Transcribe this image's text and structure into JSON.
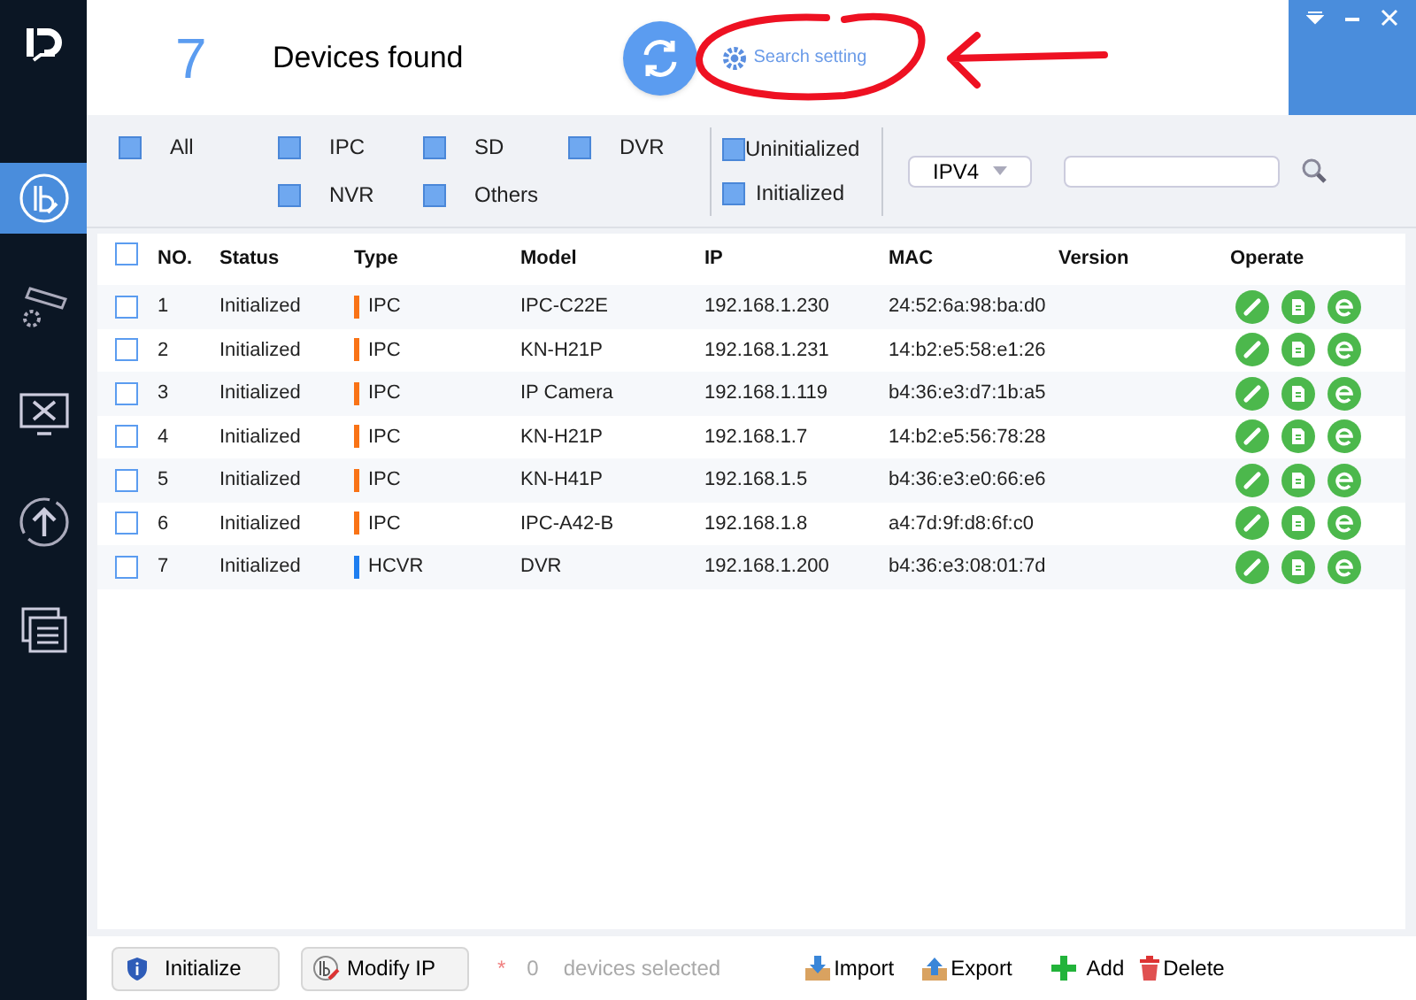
{
  "header": {
    "count": "7",
    "title": "Devices found",
    "search_setting": "Search setting"
  },
  "sidebar": {
    "items": [
      {
        "selected": true
      },
      {
        "selected": false
      },
      {
        "selected": false
      },
      {
        "selected": false
      }
    ]
  },
  "filters": {
    "types": [
      {
        "label": "All",
        "checked": true
      },
      {
        "label": "IPC",
        "checked": true
      },
      {
        "label": "SD",
        "checked": true
      },
      {
        "label": "DVR",
        "checked": true
      },
      {
        "label": "NVR",
        "checked": true
      },
      {
        "label": "Others",
        "checked": true
      }
    ],
    "states": [
      {
        "label": "Uninitialized",
        "checked": true
      },
      {
        "label": "Initialized",
        "checked": true
      }
    ],
    "protocol": "IPV4"
  },
  "table": {
    "select_all": {
      "checked": false
    },
    "columns": [
      "NO.",
      "Status",
      "Type",
      "Model",
      "IP",
      "MAC",
      "Version",
      "Operate"
    ],
    "rows": [
      {
        "no": "1",
        "status": "Initialized",
        "type": "IPC",
        "color": "#f97316",
        "model": "IPC-C22E",
        "ip": "192.168.1.230",
        "mac": "24:52:6a:98:ba:d0",
        "checked": false
      },
      {
        "no": "2",
        "status": "Initialized",
        "type": "IPC",
        "color": "#f97316",
        "model": "KN-H21P",
        "ip": "192.168.1.231",
        "mac": "14:b2:e5:58:e1:26",
        "checked": false
      },
      {
        "no": "3",
        "status": "Initialized",
        "type": "IPC",
        "color": "#f97316",
        "model": "IP Camera",
        "ip": "192.168.1.119",
        "mac": "b4:36:e3:d7:1b:a5",
        "checked": false
      },
      {
        "no": "4",
        "status": "Initialized",
        "type": "IPC",
        "color": "#f97316",
        "model": "KN-H21P",
        "ip": "192.168.1.7",
        "mac": "14:b2:e5:56:78:28",
        "checked": false
      },
      {
        "no": "5",
        "status": "Initialized",
        "type": "IPC",
        "color": "#f97316",
        "model": "KN-H41P",
        "ip": "192.168.1.5",
        "mac": "b4:36:e3:e0:66:e6",
        "checked": false
      },
      {
        "no": "6",
        "status": "Initialized",
        "type": "IPC",
        "color": "#f97316",
        "model": "IPC-A42-B",
        "ip": "192.168.1.8",
        "mac": "a4:7d:9f:d8:6f:c0",
        "checked": false
      },
      {
        "no": "7",
        "status": "Initialized",
        "type": "HCVR",
        "color": "#1e7ef0",
        "model": "DVR",
        "ip": "192.168.1.200",
        "mac": "b4:36:e3:08:01:7d",
        "checked": false
      }
    ]
  },
  "footer": {
    "initialize": "Initialize",
    "modify_ip": "Modify IP",
    "star": "*",
    "selected_count": "0",
    "selected_label": "devices selected",
    "import": "Import",
    "export": "Export",
    "add": "Add",
    "delete": "Delete"
  }
}
